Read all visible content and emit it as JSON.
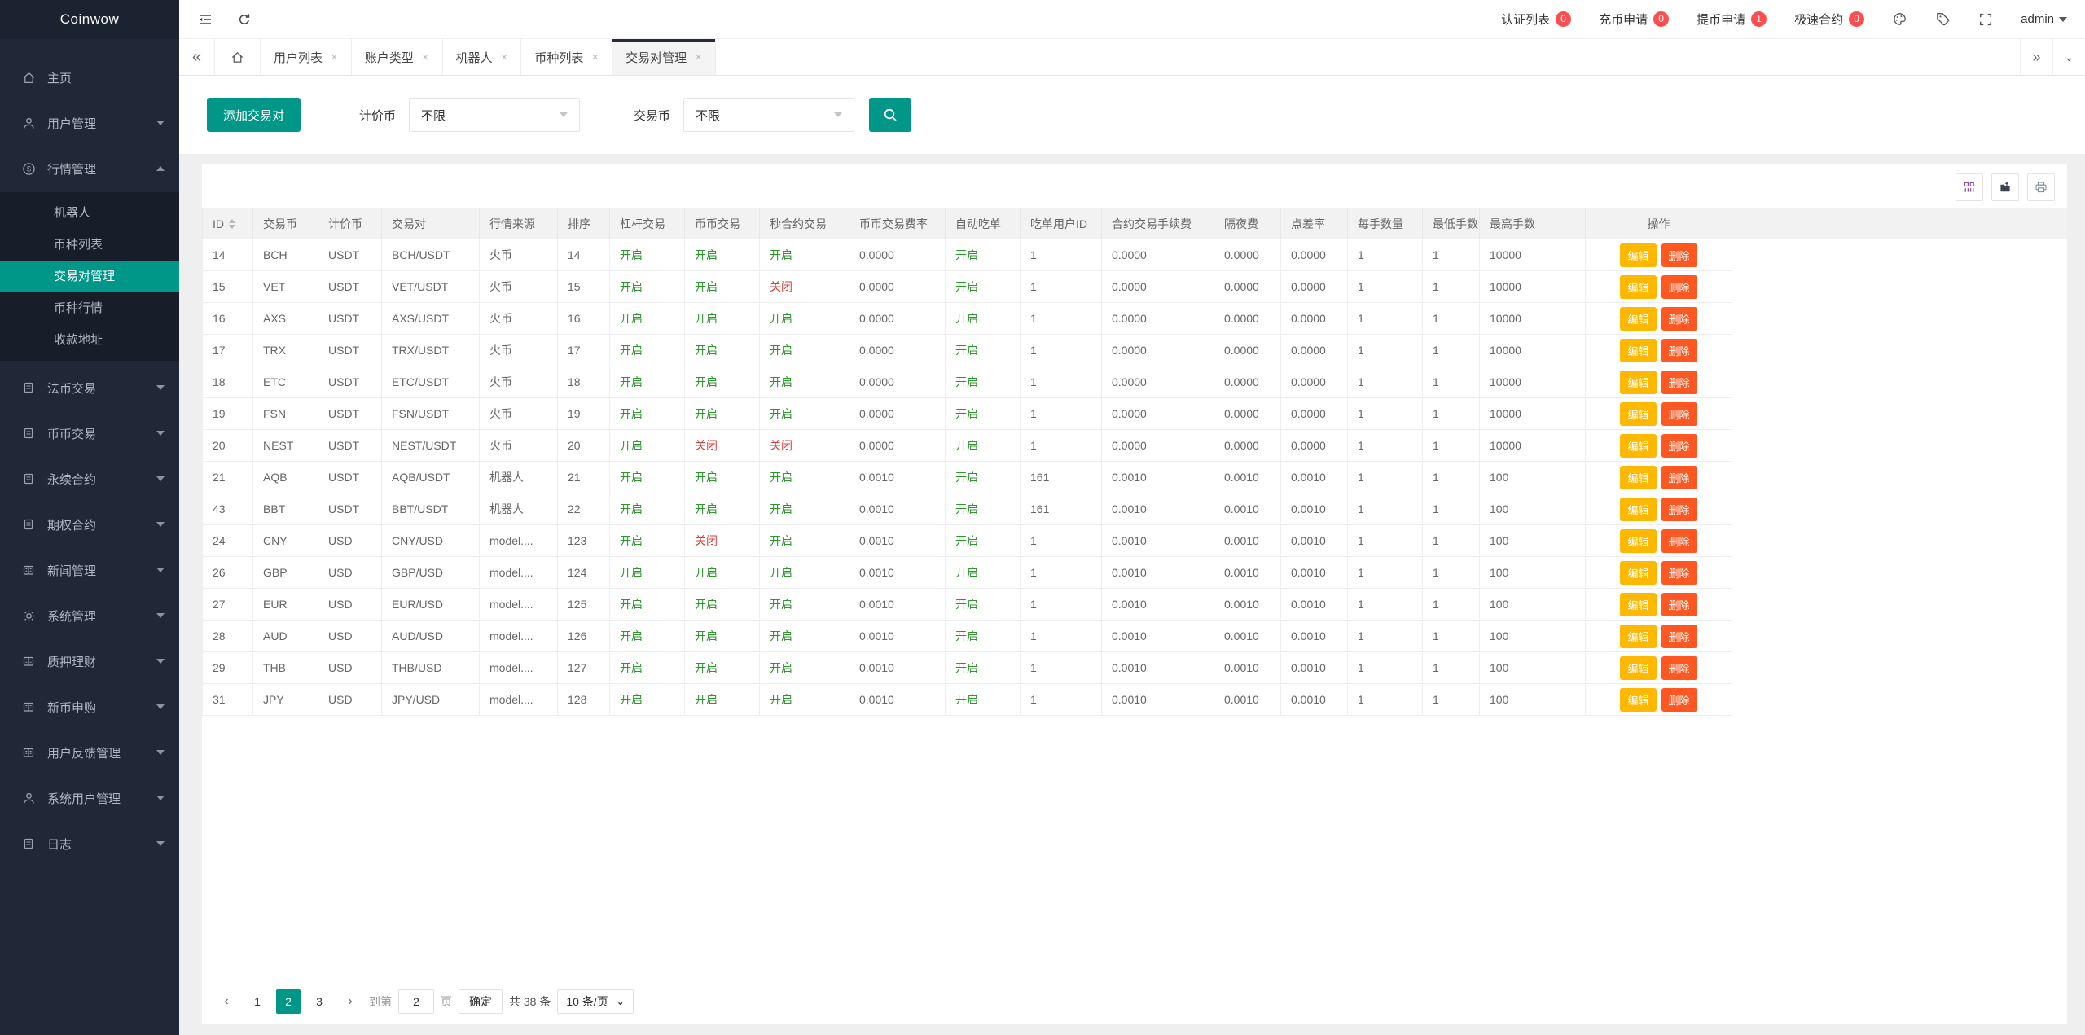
{
  "app": {
    "title": "Coinwow"
  },
  "colors": {
    "accent": "#009688",
    "status_on": "#2d962d",
    "status_off": "#d0403a",
    "edit_btn": "#ffb800",
    "delete_btn": "#ff5722",
    "badge": "#ff4d4f",
    "sidebar_bg": "#202837",
    "submenu_bg": "#181e29"
  },
  "topbar": {
    "badges": [
      {
        "label": "认证列表",
        "count": "0"
      },
      {
        "label": "充币申请",
        "count": "0"
      },
      {
        "label": "提币申请",
        "count": "1"
      },
      {
        "label": "极速合约",
        "count": "0"
      }
    ],
    "tools": [
      "palette-icon",
      "tag-icon",
      "fullscreen-icon"
    ],
    "user": {
      "name": "admin"
    }
  },
  "tabbar": {
    "tabs": [
      {
        "label": "用户列表",
        "active": false
      },
      {
        "label": "账户类型",
        "active": false
      },
      {
        "label": "机器人",
        "active": false
      },
      {
        "label": "币种列表",
        "active": false
      },
      {
        "label": "交易对管理",
        "active": true
      }
    ]
  },
  "sidebar": {
    "items": [
      {
        "label": "主页",
        "icon": "home-icon"
      },
      {
        "label": "用户管理",
        "icon": "user-icon",
        "arrow": "down"
      },
      {
        "label": "行情管理",
        "icon": "dollar-icon",
        "arrow": "up",
        "expanded": true,
        "children": [
          {
            "label": "机器人",
            "active": false
          },
          {
            "label": "币种列表",
            "active": false
          },
          {
            "label": "交易对管理",
            "active": true
          },
          {
            "label": "币种行情",
            "active": false
          },
          {
            "label": "收款地址",
            "active": false
          }
        ]
      },
      {
        "label": "法币交易",
        "icon": "doc-icon",
        "arrow": "down"
      },
      {
        "label": "币币交易",
        "icon": "doc-icon",
        "arrow": "down"
      },
      {
        "label": "永续合约",
        "icon": "doc-icon",
        "arrow": "down"
      },
      {
        "label": "期权合约",
        "icon": "doc-icon",
        "arrow": "down"
      },
      {
        "label": "新闻管理",
        "icon": "news-icon",
        "arrow": "down"
      },
      {
        "label": "系统管理",
        "icon": "gear-icon",
        "arrow": "down"
      },
      {
        "label": "质押理财",
        "icon": "news-icon",
        "arrow": "down"
      },
      {
        "label": "新币申购",
        "icon": "news-icon",
        "arrow": "down"
      },
      {
        "label": "用户反馈管理",
        "icon": "news-icon",
        "arrow": "down"
      },
      {
        "label": "系统用户管理",
        "icon": "user-icon",
        "arrow": "down"
      },
      {
        "label": "日志",
        "icon": "doc-icon",
        "arrow": "down"
      }
    ]
  },
  "filters": {
    "add_button": "添加交易对",
    "quote_label": "计价币",
    "quote_value": "不限",
    "base_label": "交易币",
    "base_value": "不限"
  },
  "table": {
    "columns": [
      "ID",
      "交易币",
      "计价币",
      "交易对",
      "行情来源",
      "排序",
      "杠杆交易",
      "币币交易",
      "秒合约交易",
      "币币交易费率",
      "自动吃单",
      "吃单用户ID",
      "合约交易手续费",
      "隔夜费",
      "点差率",
      "每手数量",
      "最低手数",
      "最高手数",
      "操作"
    ],
    "status_columns": [
      6,
      7,
      8,
      10
    ],
    "on_value": "开启",
    "off_value": "关闭",
    "actions": {
      "edit": "编辑",
      "delete": "删除"
    },
    "rows": [
      [
        "14",
        "BCH",
        "USDT",
        "BCH/USDT",
        "火币",
        "14",
        "开启",
        "开启",
        "开启",
        "0.0000",
        "开启",
        "1",
        "0.0000",
        "0.0000",
        "0.0000",
        "1",
        "1",
        "10000"
      ],
      [
        "15",
        "VET",
        "USDT",
        "VET/USDT",
        "火币",
        "15",
        "开启",
        "开启",
        "关闭",
        "0.0000",
        "开启",
        "1",
        "0.0000",
        "0.0000",
        "0.0000",
        "1",
        "1",
        "10000"
      ],
      [
        "16",
        "AXS",
        "USDT",
        "AXS/USDT",
        "火币",
        "16",
        "开启",
        "开启",
        "开启",
        "0.0000",
        "开启",
        "1",
        "0.0000",
        "0.0000",
        "0.0000",
        "1",
        "1",
        "10000"
      ],
      [
        "17",
        "TRX",
        "USDT",
        "TRX/USDT",
        "火币",
        "17",
        "开启",
        "开启",
        "开启",
        "0.0000",
        "开启",
        "1",
        "0.0000",
        "0.0000",
        "0.0000",
        "1",
        "1",
        "10000"
      ],
      [
        "18",
        "ETC",
        "USDT",
        "ETC/USDT",
        "火币",
        "18",
        "开启",
        "开启",
        "开启",
        "0.0000",
        "开启",
        "1",
        "0.0000",
        "0.0000",
        "0.0000",
        "1",
        "1",
        "10000"
      ],
      [
        "19",
        "FSN",
        "USDT",
        "FSN/USDT",
        "火币",
        "19",
        "开启",
        "开启",
        "开启",
        "0.0000",
        "开启",
        "1",
        "0.0000",
        "0.0000",
        "0.0000",
        "1",
        "1",
        "10000"
      ],
      [
        "20",
        "NEST",
        "USDT",
        "NEST/USDT",
        "火币",
        "20",
        "开启",
        "关闭",
        "关闭",
        "0.0000",
        "开启",
        "1",
        "0.0000",
        "0.0000",
        "0.0000",
        "1",
        "1",
        "10000"
      ],
      [
        "21",
        "AQB",
        "USDT",
        "AQB/USDT",
        "机器人",
        "21",
        "开启",
        "开启",
        "开启",
        "0.0010",
        "开启",
        "161",
        "0.0010",
        "0.0010",
        "0.0010",
        "1",
        "1",
        "100"
      ],
      [
        "43",
        "BBT",
        "USDT",
        "BBT/USDT",
        "机器人",
        "22",
        "开启",
        "开启",
        "开启",
        "0.0010",
        "开启",
        "161",
        "0.0010",
        "0.0010",
        "0.0010",
        "1",
        "1",
        "100"
      ],
      [
        "24",
        "CNY",
        "USD",
        "CNY/USD",
        "model....",
        "123",
        "开启",
        "关闭",
        "开启",
        "0.0010",
        "开启",
        "1",
        "0.0010",
        "0.0010",
        "0.0010",
        "1",
        "1",
        "100"
      ],
      [
        "26",
        "GBP",
        "USD",
        "GBP/USD",
        "model....",
        "124",
        "开启",
        "开启",
        "开启",
        "0.0010",
        "开启",
        "1",
        "0.0010",
        "0.0010",
        "0.0010",
        "1",
        "1",
        "100"
      ],
      [
        "27",
        "EUR",
        "USD",
        "EUR/USD",
        "model....",
        "125",
        "开启",
        "开启",
        "开启",
        "0.0010",
        "开启",
        "1",
        "0.0010",
        "0.0010",
        "0.0010",
        "1",
        "1",
        "100"
      ],
      [
        "28",
        "AUD",
        "USD",
        "AUD/USD",
        "model....",
        "126",
        "开启",
        "开启",
        "开启",
        "0.0010",
        "开启",
        "1",
        "0.0010",
        "0.0010",
        "0.0010",
        "1",
        "1",
        "100"
      ],
      [
        "29",
        "THB",
        "USD",
        "THB/USD",
        "model....",
        "127",
        "开启",
        "开启",
        "开启",
        "0.0010",
        "开启",
        "1",
        "0.0010",
        "0.0010",
        "0.0010",
        "1",
        "1",
        "100"
      ],
      [
        "31",
        "JPY",
        "USD",
        "JPY/USD",
        "model....",
        "128",
        "开启",
        "开启",
        "开启",
        "0.0010",
        "开启",
        "1",
        "0.0010",
        "0.0010",
        "0.0010",
        "1",
        "1",
        "100"
      ]
    ]
  },
  "pagination": {
    "pages": [
      "1",
      "2",
      "3"
    ],
    "current": "2",
    "jump_prefix": "到第",
    "jump_value": "2",
    "jump_suffix": "页",
    "confirm_label": "确定",
    "total_label": "共 38 条",
    "page_size_label": "10 条/页"
  }
}
